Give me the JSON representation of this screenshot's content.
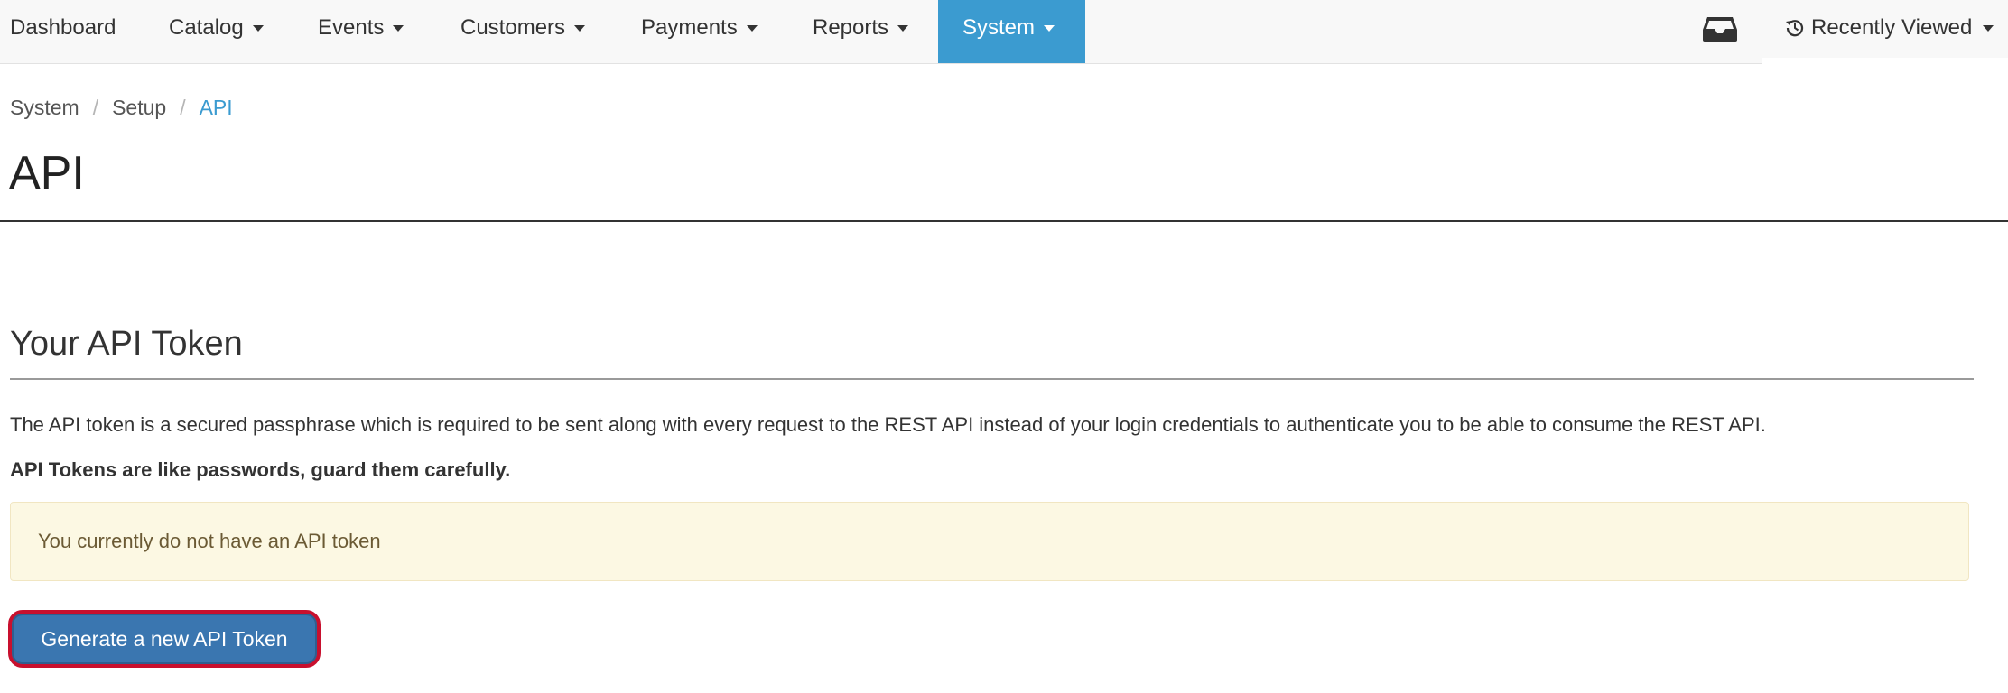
{
  "nav": {
    "items": [
      {
        "label": "Dashboard",
        "dropdown": false
      },
      {
        "label": "Catalog",
        "dropdown": true
      },
      {
        "label": "Events",
        "dropdown": true
      },
      {
        "label": "Customers",
        "dropdown": true
      },
      {
        "label": "Payments",
        "dropdown": true
      },
      {
        "label": "Reports",
        "dropdown": true
      },
      {
        "label": "System",
        "dropdown": true,
        "active": true
      }
    ],
    "inbox_icon": "inbox-icon",
    "recently_viewed": {
      "label": "Recently Viewed",
      "icon": "history-icon"
    }
  },
  "breadcrumb": [
    {
      "label": "System"
    },
    {
      "label": "Setup"
    },
    {
      "label": "API",
      "current": true
    }
  ],
  "page_title": "API",
  "token_section": {
    "title": "Your API Token",
    "description": "The API token is a secured passphrase which is required to be sent along with every request to the REST API instead of your login credentials to authenticate you to be able to consume the REST API.",
    "warning": "API Tokens are like passwords, guard them carefully.",
    "alert": "You currently do not have an API token",
    "generate_button": "Generate a new API Token"
  },
  "colors": {
    "navbar_bg": "#f8f8f8",
    "active_nav": "#3b9bd0",
    "link": "#3b9bd0",
    "alert_bg": "#fcf8e3",
    "button_bg": "#3a76b0",
    "button_highlight": "#c8102e"
  }
}
